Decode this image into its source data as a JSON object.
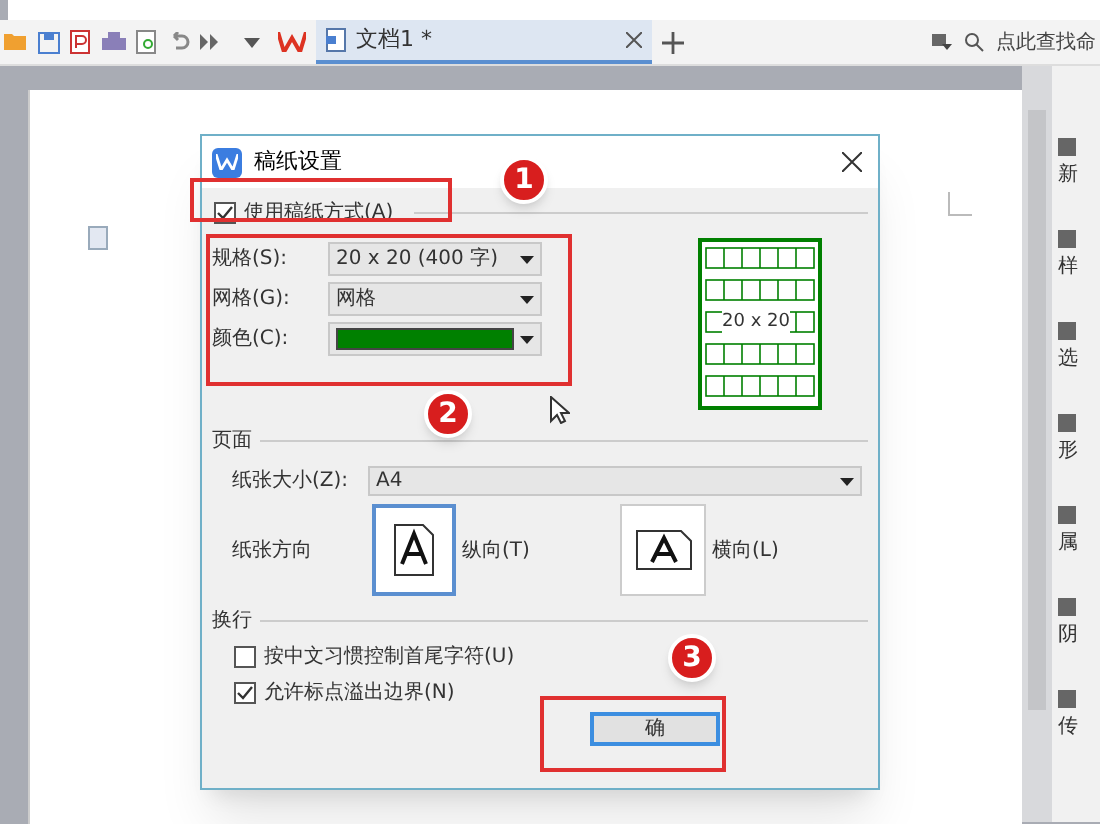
{
  "tab": {
    "title": "文档1 *"
  },
  "search": {
    "placeholder": "点此查找命"
  },
  "dialog": {
    "title": "稿纸设置",
    "use_grid": {
      "label": "使用稿纸方式(A)",
      "checked": true
    },
    "fields": [
      {
        "label": "规格(S):",
        "kind": "text",
        "value": "20 x 20 (400 字)"
      },
      {
        "label": "网格(G):",
        "kind": "text",
        "value": "网格"
      },
      {
        "label": "颜色(C):",
        "kind": "color",
        "color": "#008000"
      }
    ],
    "preview": {
      "label": "20 x 20"
    },
    "page": {
      "heading": "页面",
      "size_label": "纸张大小(Z):",
      "size_value": "A4",
      "orientation_label": "纸张方向",
      "orientations": [
        {
          "label": "纵向(T)",
          "kind": "portrait",
          "selected": true
        },
        {
          "label": "横向(L)",
          "kind": "landscape",
          "selected": false
        }
      ]
    },
    "wrap": {
      "heading": "换行",
      "options": [
        {
          "label": "按中文习惯控制首尾字符(U)",
          "checked": false
        },
        {
          "label": "允许标点溢出边界(N)",
          "checked": true
        }
      ]
    },
    "ok_button": "确"
  },
  "annotations": [
    "1",
    "2",
    "3"
  ],
  "side_panel": [
    "新",
    "样",
    "选",
    "形",
    "属",
    "阴",
    "传"
  ]
}
